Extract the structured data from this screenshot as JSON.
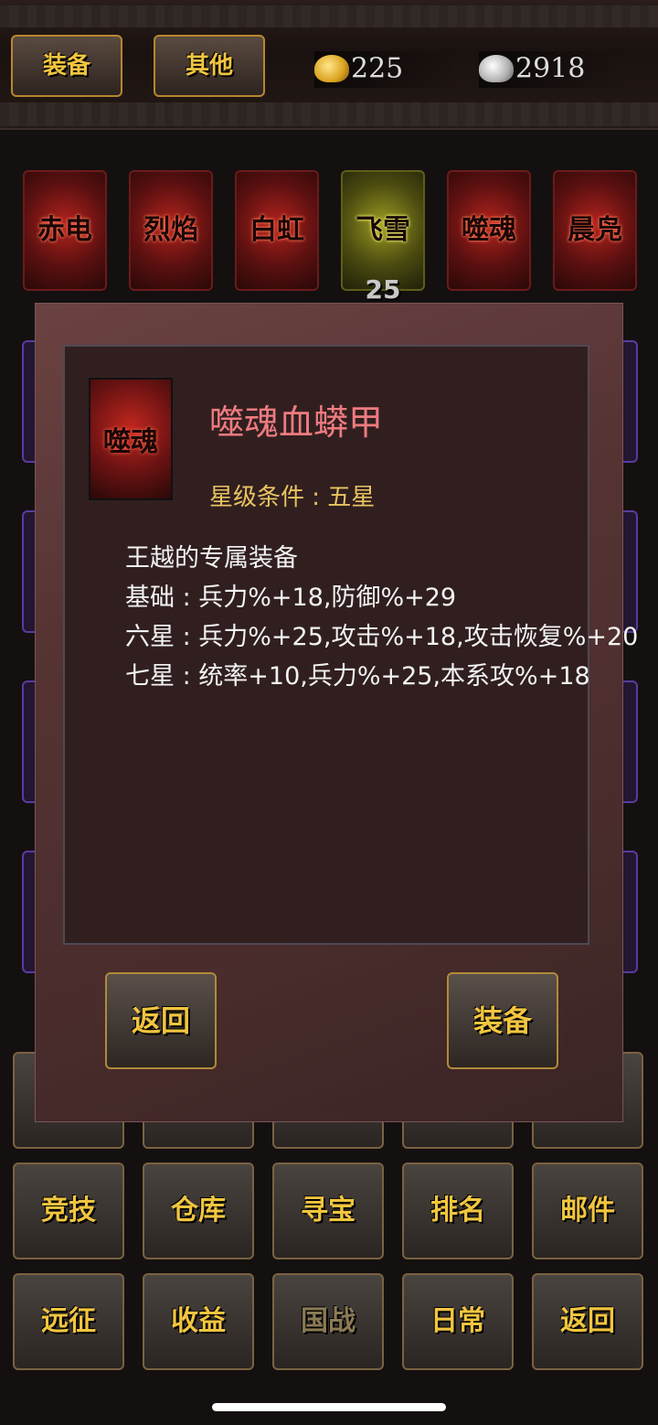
{
  "tabs": {
    "equip": "装备",
    "other": "其他"
  },
  "currency": {
    "gold": "225",
    "silver": "2918"
  },
  "equip_slots": [
    {
      "label": "赤电",
      "style": "red"
    },
    {
      "label": "烈焰",
      "style": "red"
    },
    {
      "label": "白虹",
      "style": "red"
    },
    {
      "label": "飞雪",
      "style": "gold"
    },
    {
      "label": "噬魂",
      "style": "red"
    },
    {
      "label": "晨凫",
      "style": "red"
    }
  ],
  "selected_slot_level": "25",
  "dialog": {
    "icon_label": "噬魂",
    "item_name": "噬魂血蟒甲",
    "star_requirement": "星级条件 : 五星",
    "description": [
      "王越的专属装备",
      "基础 : 兵力%+18,防御%+29",
      "六星 : 兵力%+25,攻击%+18,攻击恢复%+20",
      "七星 : 统率+10,兵力%+25,本系攻%+18"
    ],
    "back_label": "返回",
    "equip_label": "装备"
  },
  "bottom_menu": {
    "row2": [
      "竞技",
      "仓库",
      "寻宝",
      "排名",
      "邮件"
    ],
    "row3": [
      "远征",
      "收益",
      "国战",
      "日常",
      "返回"
    ]
  }
}
